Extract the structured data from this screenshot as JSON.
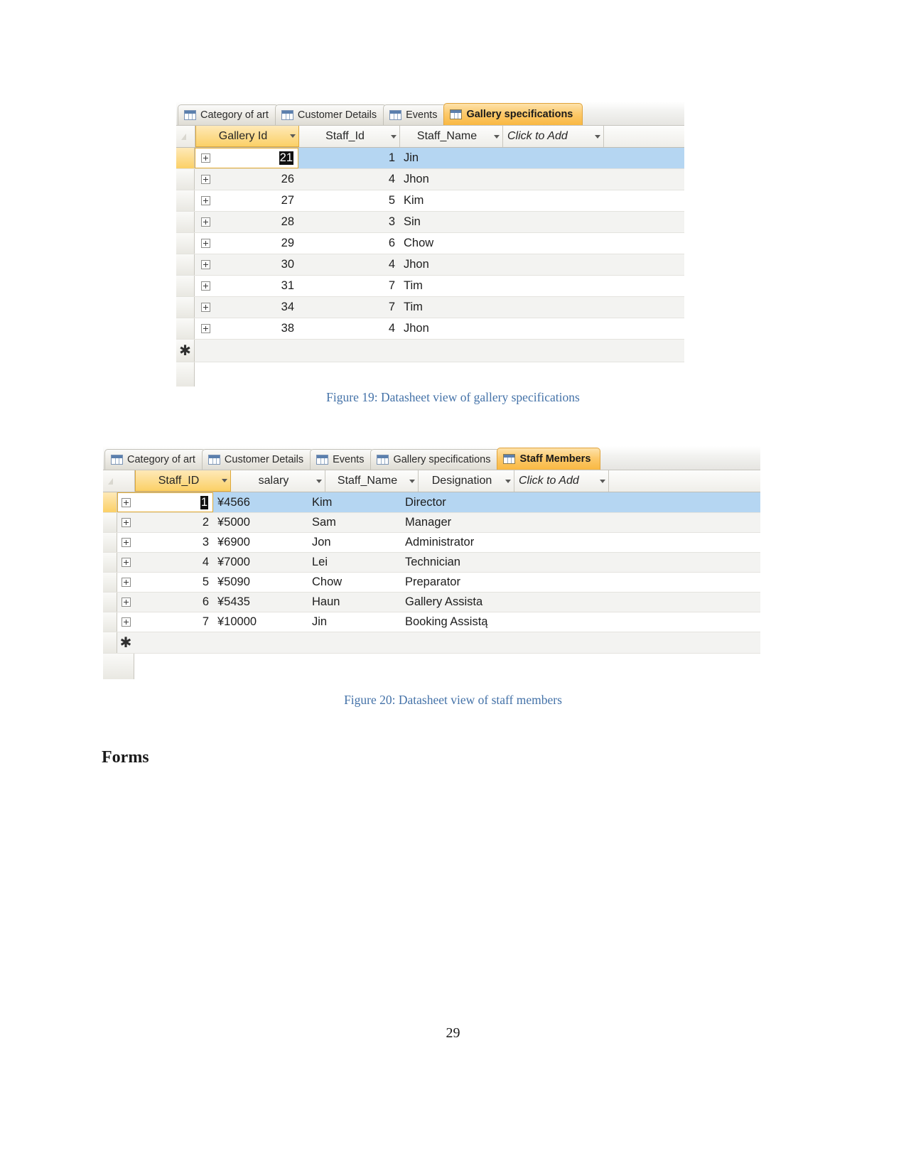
{
  "page": {
    "number": "29",
    "section_heading": "Forms"
  },
  "figure19": {
    "caption": "Figure 19: Datasheet view of gallery specifications",
    "tabs": [
      {
        "label": "Category of art",
        "active": false
      },
      {
        "label": "Customer Details",
        "active": false
      },
      {
        "label": "Events",
        "active": false
      },
      {
        "label": "Gallery specifications",
        "active": true
      }
    ],
    "columns": [
      {
        "label": "Gallery Id",
        "key": true
      },
      {
        "label": "Staff_Id",
        "key": false
      },
      {
        "label": "Staff_Name",
        "key": false
      },
      {
        "label": "Click to Add",
        "key": false
      }
    ],
    "rows": [
      {
        "gallery_id": "21",
        "staff_id": "1",
        "staff_name": "Jin",
        "selected": true
      },
      {
        "gallery_id": "26",
        "staff_id": "4",
        "staff_name": "Jhon",
        "selected": false
      },
      {
        "gallery_id": "27",
        "staff_id": "5",
        "staff_name": "Kim",
        "selected": false
      },
      {
        "gallery_id": "28",
        "staff_id": "3",
        "staff_name": "Sin",
        "selected": false
      },
      {
        "gallery_id": "29",
        "staff_id": "6",
        "staff_name": "Chow",
        "selected": false
      },
      {
        "gallery_id": "30",
        "staff_id": "4",
        "staff_name": "Jhon",
        "selected": false
      },
      {
        "gallery_id": "31",
        "staff_id": "7",
        "staff_name": "Tim",
        "selected": false
      },
      {
        "gallery_id": "34",
        "staff_id": "7",
        "staff_name": "Tim",
        "selected": false
      },
      {
        "gallery_id": "38",
        "staff_id": "4",
        "staff_name": "Jhon",
        "selected": false
      }
    ],
    "new_record_marker": "✱"
  },
  "figure20": {
    "caption": "Figure 20: Datasheet view of staff members",
    "tabs": [
      {
        "label": "Category of art",
        "active": false
      },
      {
        "label": "Customer Details",
        "active": false
      },
      {
        "label": "Events",
        "active": false
      },
      {
        "label": "Gallery specifications",
        "active": false
      },
      {
        "label": "Staff Members",
        "active": true
      }
    ],
    "columns": [
      {
        "label": "Staff_ID",
        "key": true
      },
      {
        "label": "salary",
        "key": false
      },
      {
        "label": "Staff_Name",
        "key": false
      },
      {
        "label": "Designation",
        "key": false
      },
      {
        "label": "Click to Add",
        "key": false
      }
    ],
    "rows": [
      {
        "staff_id": "1",
        "salary": "¥4566",
        "staff_name": "Kim",
        "designation": "Director",
        "selected": true
      },
      {
        "staff_id": "2",
        "salary": "¥5000",
        "staff_name": "Sam",
        "designation": "Manager",
        "selected": false
      },
      {
        "staff_id": "3",
        "salary": "¥6900",
        "staff_name": "Jon",
        "designation": "Administrator",
        "selected": false
      },
      {
        "staff_id": "4",
        "salary": "¥7000",
        "staff_name": "Lei",
        "designation": "Technician",
        "selected": false
      },
      {
        "staff_id": "5",
        "salary": "¥5090",
        "staff_name": "Chow",
        "designation": "Preparator",
        "selected": false
      },
      {
        "staff_id": "6",
        "salary": "¥5435",
        "staff_name": "Haun",
        "designation": "Gallery Assista",
        "selected": false
      },
      {
        "staff_id": "7",
        "salary": "¥10000",
        "staff_name": "Jin",
        "designation": "Booking Assistą",
        "selected": false
      }
    ],
    "new_record_marker": "✱"
  },
  "colors": {
    "accent_orange": "#f9b842",
    "key_column": "#fbd066",
    "selection_blue": "#b5d6f2",
    "caption_blue": "#4472a8"
  }
}
